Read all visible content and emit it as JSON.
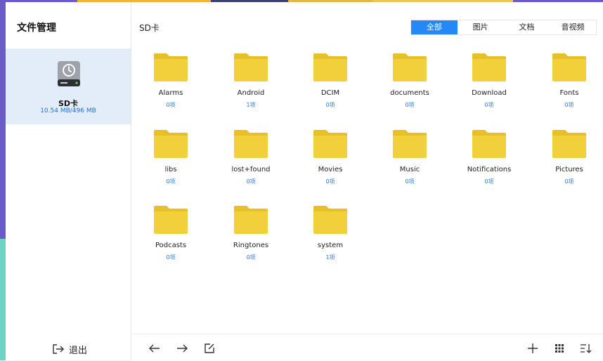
{
  "app": {
    "title": "文件管理"
  },
  "sidebar": {
    "device_name": "SD卡",
    "device_size": "10.54 MB/496 MB",
    "exit_label": "退出"
  },
  "main": {
    "path": "SD卡",
    "tabs": [
      {
        "label": "全部",
        "active": true
      },
      {
        "label": "图片",
        "active": false
      },
      {
        "label": "文档",
        "active": false
      },
      {
        "label": "音视频",
        "active": false
      }
    ],
    "folders": [
      {
        "name": "Alarms",
        "count": "0项"
      },
      {
        "name": "Android",
        "count": "1项"
      },
      {
        "name": "DCIM",
        "count": "0项"
      },
      {
        "name": "documents",
        "count": "0项"
      },
      {
        "name": "Download",
        "count": "0项"
      },
      {
        "name": "Fonts",
        "count": "0项"
      },
      {
        "name": "libs",
        "count": "0项"
      },
      {
        "name": "lost+found",
        "count": "0项"
      },
      {
        "name": "Movies",
        "count": "0项"
      },
      {
        "name": "Music",
        "count": "0项"
      },
      {
        "name": "Notifications",
        "count": "0项"
      },
      {
        "name": "Pictures",
        "count": "0项"
      },
      {
        "name": "Podcasts",
        "count": "0项"
      },
      {
        "name": "Ringtones",
        "count": "0项"
      },
      {
        "name": "system",
        "count": "1项"
      }
    ]
  },
  "colors": {
    "accent": "#2489f5",
    "folder": "#f2d03b",
    "folder_tab": "#e6bf2a",
    "count_text": "#2a7ad8",
    "selected_bg": "#e3edfa"
  },
  "icons": {
    "back": "arrow-left-icon",
    "forward": "arrow-right-icon",
    "rename": "edit-icon",
    "add": "plus-icon",
    "view": "grid-view-icon",
    "sort": "sort-icon",
    "exit": "exit-icon",
    "device": "hard-drive-icon",
    "folder": "folder-icon"
  }
}
